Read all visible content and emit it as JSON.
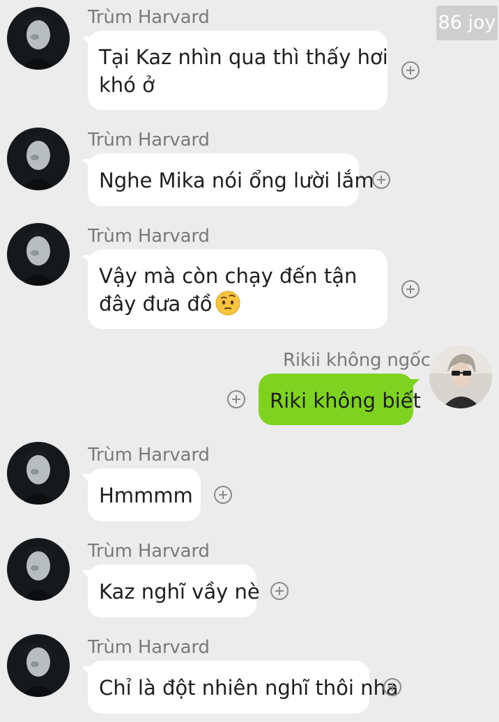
{
  "watermark": "86 joy",
  "messages": [
    {
      "sender": "Trùm Harvard",
      "lines": [
        "Tại Kaz nhìn qua thì thấy hơi",
        "khó ở"
      ]
    },
    {
      "sender": "Trùm Harvard",
      "lines": [
        "Nghe Mika nói ổng lười lắm"
      ]
    },
    {
      "sender": "Trùm Harvard",
      "lines": [
        "Vậy mà còn chạy đến tận",
        "đây đưa đồ"
      ],
      "emoji": "face-with-raised-eyebrow-icon"
    },
    {
      "sender": "Rikii không ngốc",
      "lines": [
        "Riki không biết"
      ],
      "outgoing": true
    },
    {
      "sender": "Trùm Harvard",
      "lines": [
        "Hmmmm"
      ]
    },
    {
      "sender": "Trùm Harvard",
      "lines": [
        "Kaz nghĩ vầy nè"
      ]
    },
    {
      "sender": "Trùm Harvard",
      "lines": [
        "Chỉ là đột nhiên nghĩ thôi nha"
      ]
    }
  ],
  "colors": {
    "background": "#ececec",
    "incoming_bubble": "#ffffff",
    "outgoing_bubble": "#7ed321",
    "sender_text": "#7a7a7a"
  },
  "icons": {
    "add_reaction": "plus-circle-icon"
  }
}
